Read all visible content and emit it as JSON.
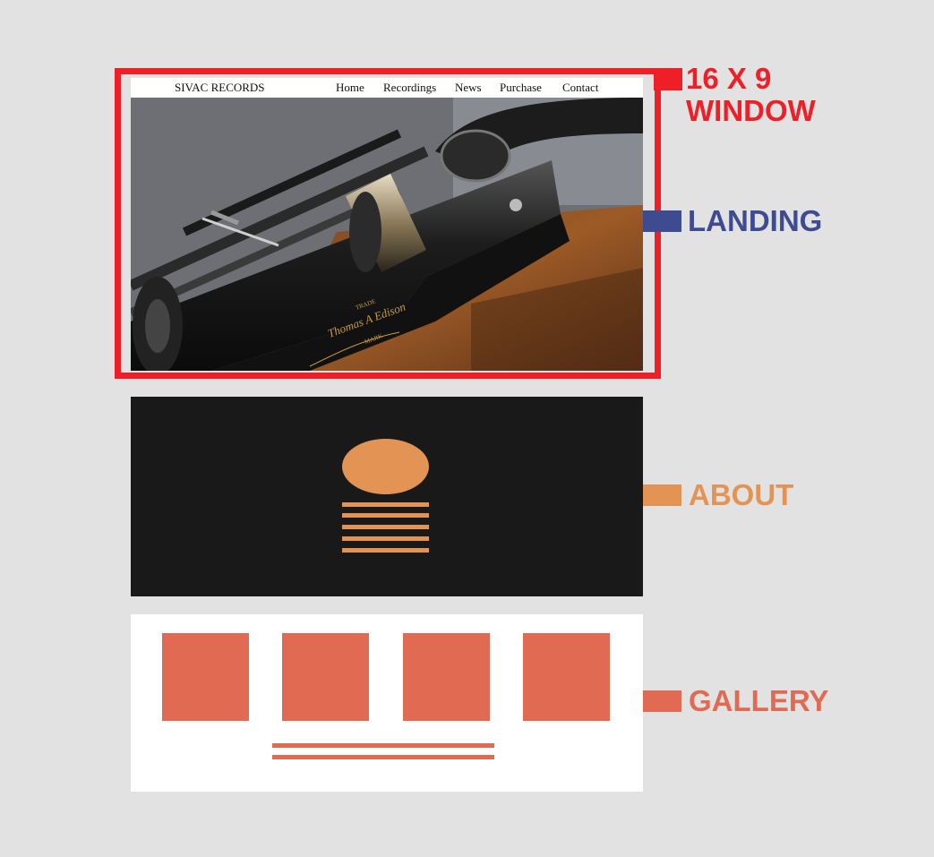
{
  "landing": {
    "nav": {
      "brand": "SIVAC RECORDS",
      "items": [
        "Home",
        "Recordings",
        "News",
        "Purchase",
        "Contact"
      ]
    },
    "hero_text": {
      "trade": "TRADE",
      "signature": "Thomas A Edison",
      "mark": "MARK"
    }
  },
  "labels": {
    "window_line1": "16 X 9",
    "window_line2": "WINDOW",
    "landing": "LANDING",
    "about": "ABOUT",
    "gallery": "GALLERY"
  },
  "colors": {
    "window": "#ee1f27",
    "landing": "#3f4b91",
    "about": "#e39455",
    "gallery": "#e16a53",
    "about_bg": "#1a1919"
  }
}
